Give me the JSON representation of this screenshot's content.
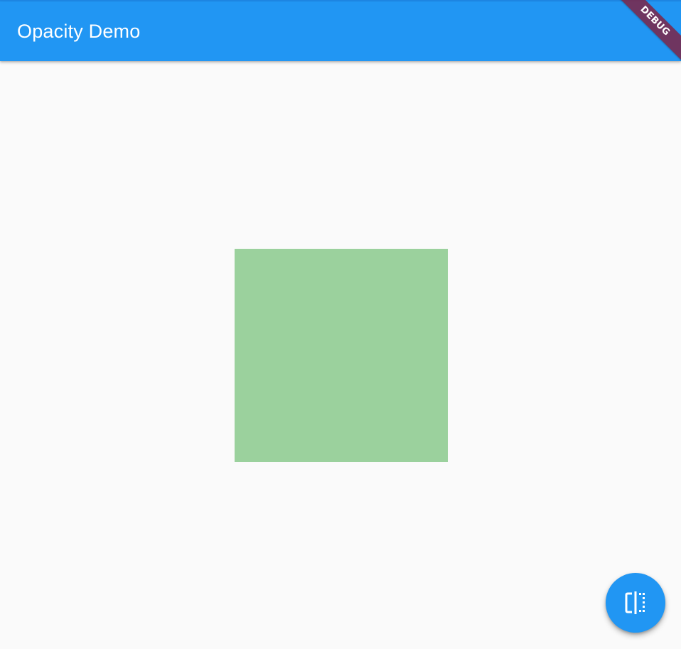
{
  "app_bar": {
    "title": "Opacity Demo",
    "color": "#2196F3"
  },
  "debug_banner": {
    "label": "DEBUG",
    "color": "#802040"
  },
  "content": {
    "box": {
      "color": "#4CAF50",
      "opacity": 0.55
    }
  },
  "fab": {
    "icon": "flip-icon",
    "color": "#2196F3"
  },
  "background": "#FAFAFA"
}
